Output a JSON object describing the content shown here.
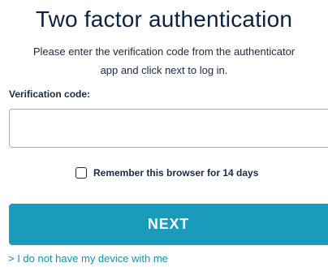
{
  "header": {
    "title": "Two factor authentication",
    "instruction_line1": "Please enter the verification code from the authenticator",
    "instruction_line2": "app and click next to log in."
  },
  "form": {
    "code_label": "Verification code:",
    "code_value": "",
    "code_placeholder": "",
    "remember_label": "Remember this browser for 14 days",
    "remember_checked": false,
    "next_label": "NEXT",
    "no_device_link": "> I do not have my device with me"
  },
  "colors": {
    "title": "#0d2240",
    "button": "#1a9bbc",
    "link": "#1a8fb0"
  }
}
